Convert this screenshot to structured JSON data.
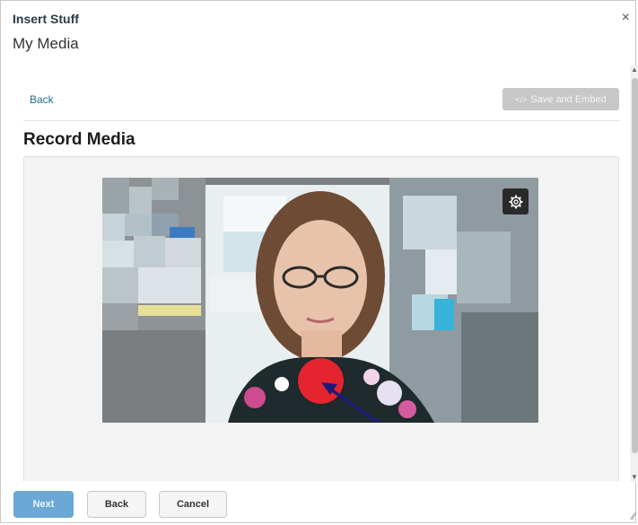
{
  "dialog": {
    "title": "Insert Stuff",
    "close_label": "×",
    "subtitle": "My Media"
  },
  "toolbar": {
    "back_label": "Back",
    "save_embed_label": "Save and Embed",
    "save_embed_icon": "code-icon"
  },
  "content": {
    "section_title": "Record Media",
    "video": {
      "settings_icon": "gear-icon",
      "record_button_icon": "record-icon",
      "record_color": "#e4252f",
      "annotation_color": "#1e1a7a"
    }
  },
  "footer": {
    "next_label": "Next",
    "back_label": "Back",
    "cancel_label": "Cancel"
  },
  "colors": {
    "link": "#2a6a8e",
    "primary_button": "#6ba8d6",
    "disabled_button": "#c7c7c7"
  }
}
